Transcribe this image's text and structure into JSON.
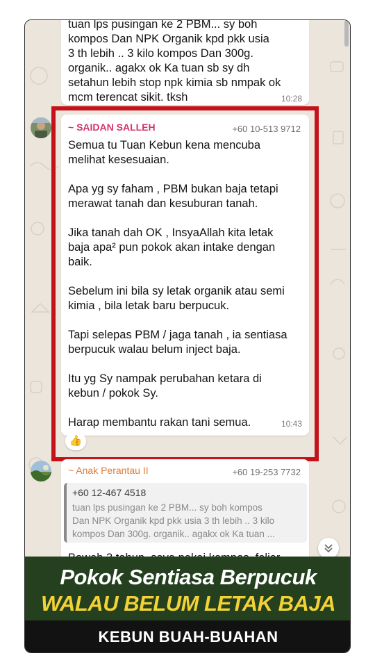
{
  "message_prev": {
    "text": "tuan lps pusingan ke 2 PBM... sy boh\nkompos Dan NPK Organik kpd pkk usia\n3 th lebih .. 3 kilo kompos Dan 300g.\norganik.. agakx ok Ka tuan sb sy dh\nsetahun lebih stop npk kimia sb nmpak ok\nmcm terencat sikit. tksh",
    "time": "10:28"
  },
  "message_main": {
    "sender": "~ SAIDAN SALLEH",
    "phone": "+60 10-513 9712",
    "text": "Semua tu Tuan Kebun kena mencuba\nmelihat kesesuaian.\n\nApa yg sy faham , PBM bukan baja tetapi\nmerawat tanah dan kesuburan tanah.\n\nJika tanah dah OK , InsyaAllah kita letak\nbaja apa² pun pokok akan intake dengan\nbaik.\n\nSebelum ini bila sy letak organik atau semi\nkimia , bila letak baru berpucuk.\n\nTapi selepas PBM / jaga tanah , ia sentiasa\nberpucuk walau belum inject baja.\n\nItu yg Sy nampak perubahan ketara di\nkebun / pokok Sy.\n\nHarap membantu rakan tani semua.",
    "time": "10:43",
    "reaction": "👍"
  },
  "message_next": {
    "sender": "~ Anak Perantau II",
    "phone": "+60 19-253 7732",
    "quote_phone": "+60 12-467 4518",
    "quote_text": "tuan lps pusingan ke 2 PBM... sy boh kompos\nDan NPK Organik kpd pkk usia 3 th lebih .. 3 kilo\nkompos Dan 300g. organik.. agakx ok Ka tuan ...",
    "text_partial": "Bawah 3 tahun, saya pakai kompos, foliar"
  },
  "banner": {
    "line1": "Pokok Sentiasa Berpucuk",
    "line2": "WALAU BELUM LETAK BAJA"
  },
  "footer": {
    "label": "KEBUN BUAH-BUAHAN"
  },
  "colors": {
    "highlight": "#c5121a",
    "sender_main": "#d6336c",
    "sender_next": "#e07a3a",
    "banner_bg": "#24401f",
    "banner_accent": "#f2d236"
  }
}
